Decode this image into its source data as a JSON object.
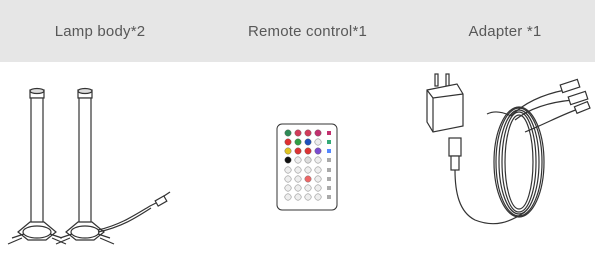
{
  "header": {
    "items": [
      {
        "label": "Lamp body*2"
      },
      {
        "label": "Remote control*1"
      },
      {
        "label": "Adapter *1"
      }
    ]
  },
  "illustrations": [
    {
      "name": "lamp-bodies",
      "count": 2
    },
    {
      "name": "remote-control",
      "count": 1
    },
    {
      "name": "adapter",
      "count": 1
    }
  ]
}
